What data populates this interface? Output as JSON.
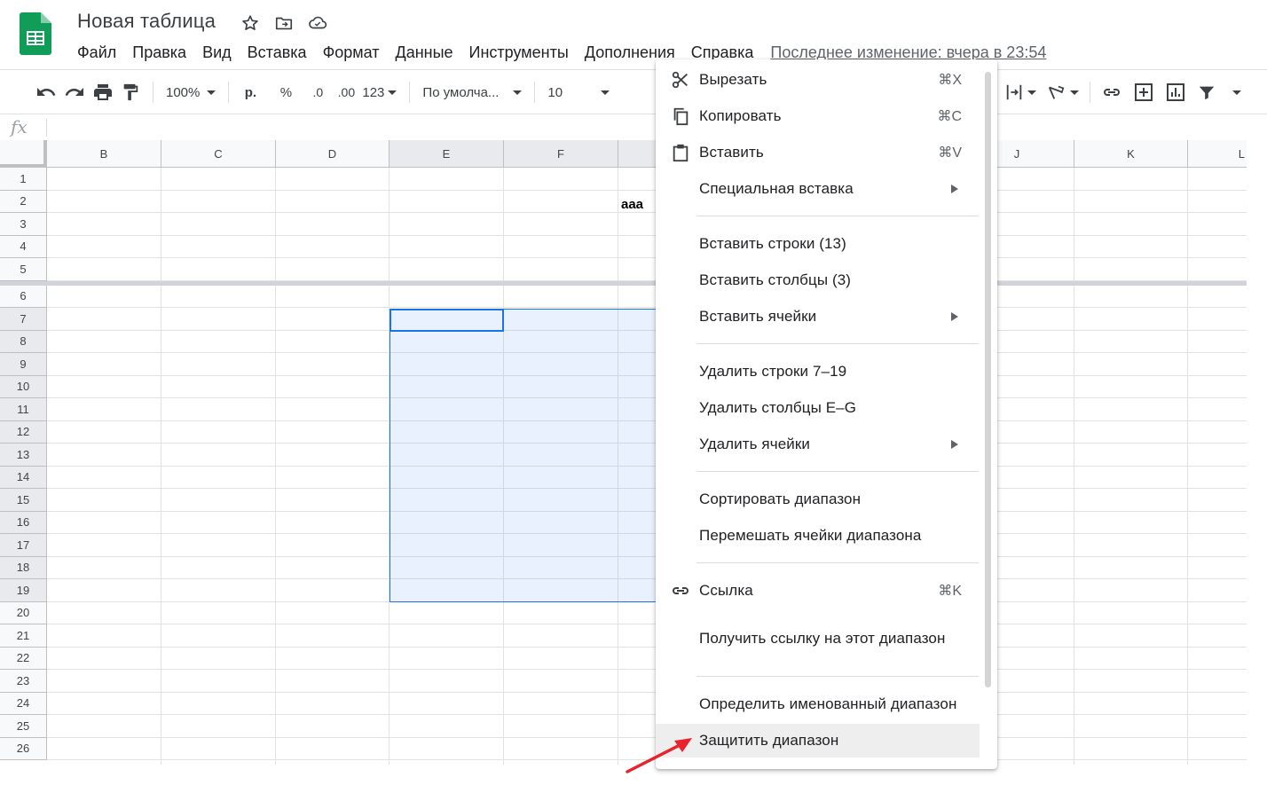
{
  "doc_title": "Новая таблица",
  "menu": [
    "Файл",
    "Правка",
    "Вид",
    "Вставка",
    "Формат",
    "Данные",
    "Инструменты",
    "Дополнения",
    "Справка"
  ],
  "last_edit": "Последнее изменение: вчера в 23:54",
  "toolbar": {
    "zoom": "100%",
    "currency": "р.",
    "percent": "%",
    "dec_minus": ".0",
    "dec_plus": ".00",
    "format_more": "123",
    "font": "По умолча...",
    "font_size": "10"
  },
  "formula_label": "fx",
  "columns": [
    "B",
    "C",
    "D",
    "E",
    "F",
    "",
    "J",
    "K",
    "L"
  ],
  "rows": [
    "1",
    "2",
    "3",
    "4",
    "5",
    "6",
    "7",
    "8",
    "9",
    "10",
    "11",
    "12",
    "13",
    "14",
    "15",
    "16",
    "17",
    "18",
    "19",
    "20",
    "21",
    "22",
    "23",
    "24",
    "25",
    "26"
  ],
  "cell_g2": "aaa",
  "context_menu": {
    "cut": {
      "label": "Вырезать",
      "shortcut": "⌘X"
    },
    "copy": {
      "label": "Копировать",
      "shortcut": "⌘C"
    },
    "paste": {
      "label": "Вставить",
      "shortcut": "⌘V"
    },
    "paste_special": {
      "label": "Специальная вставка"
    },
    "insert_rows": {
      "label": "Вставить строки (13)"
    },
    "insert_cols": {
      "label": "Вставить столбцы (3)"
    },
    "insert_cells": {
      "label": "Вставить ячейки"
    },
    "delete_rows": {
      "label": "Удалить строки 7–19"
    },
    "delete_cols": {
      "label": "Удалить столбцы E–G"
    },
    "delete_cells": {
      "label": "Удалить ячейки"
    },
    "sort_range": {
      "label": "Сортировать диапазон"
    },
    "shuffle_range": {
      "label": "Перемешать ячейки диапазона"
    },
    "link": {
      "label": "Ссылка",
      "shortcut": "⌘K"
    },
    "get_link": {
      "label": "Получить ссылку на этот диапазон"
    },
    "named_range": {
      "label": "Определить именованный диапазон"
    },
    "protect_range": {
      "label": "Защитить диапазон"
    }
  },
  "colors": {
    "accent": "#1a73e8",
    "sheets_green": "#0f9d58",
    "arrow": "#e8232b"
  }
}
